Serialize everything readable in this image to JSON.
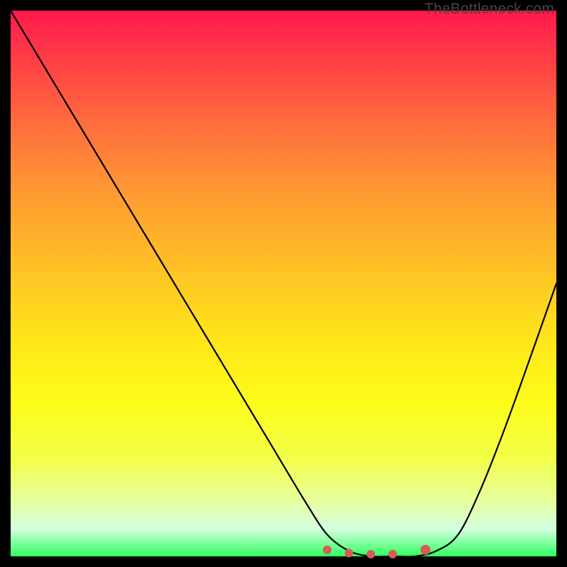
{
  "watermark": "TheBottleneck.com",
  "chart_data": {
    "type": "line",
    "title": "",
    "xlabel": "",
    "ylabel": "",
    "xlim": [
      0,
      100
    ],
    "ylim": [
      0,
      100
    ],
    "grid": false,
    "legend": false,
    "series": [
      {
        "name": "bottleneck-curve",
        "color": "#000000",
        "x": [
          0,
          6,
          12,
          18,
          24,
          30,
          36,
          42,
          48,
          54,
          58,
          62,
          66,
          70,
          74,
          78,
          82,
          86,
          90,
          94,
          100
        ],
        "y": [
          100,
          90,
          80,
          70,
          60,
          50,
          40,
          30,
          20,
          10,
          4,
          1,
          0,
          0,
          0,
          1,
          4,
          12,
          22,
          33,
          50
        ]
      }
    ],
    "markers": [
      {
        "name": "flat-region-left",
        "x": 58,
        "y": 1.2,
        "color": "#d85a5a",
        "r": 6
      },
      {
        "name": "flat-region-mid1",
        "x": 62,
        "y": 0.6,
        "color": "#d85a5a",
        "r": 6
      },
      {
        "name": "flat-region-mid2",
        "x": 66,
        "y": 0.4,
        "color": "#d85a5a",
        "r": 6
      },
      {
        "name": "flat-region-mid3",
        "x": 70,
        "y": 0.4,
        "color": "#d85a5a",
        "r": 6
      },
      {
        "name": "flat-region-right",
        "x": 76,
        "y": 1.2,
        "color": "#d85a5a",
        "r": 7
      }
    ]
  }
}
